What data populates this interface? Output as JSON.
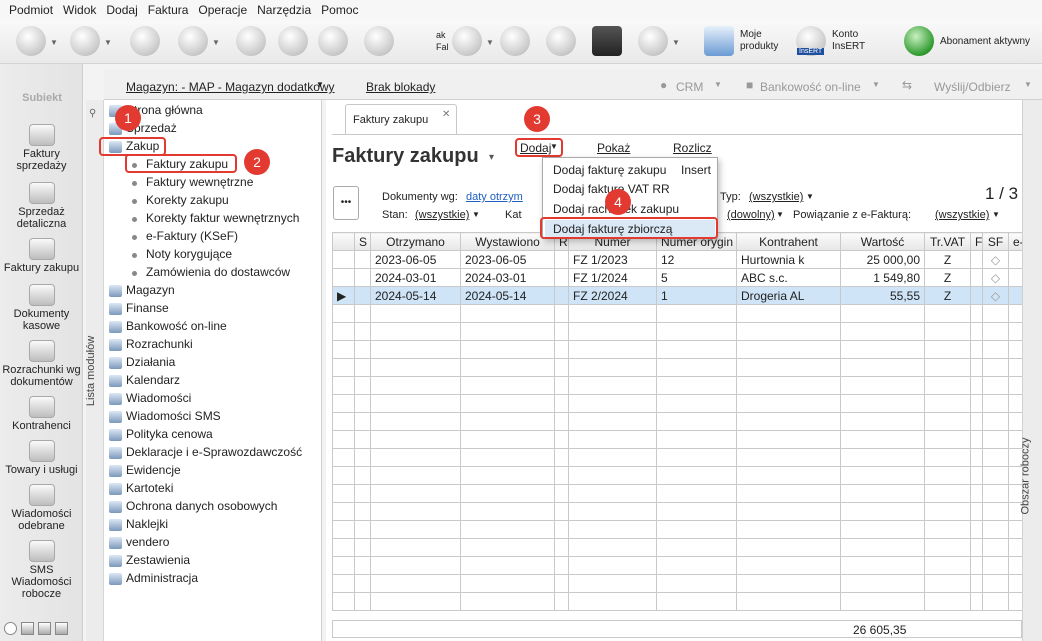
{
  "menu": [
    "Podmiot",
    "Widok",
    "Dodaj",
    "Faktura",
    "Operacje",
    "Narzędzia",
    "Pomoc"
  ],
  "toolbar": {
    "partial_text": "ak\nFal",
    "moje_produkty": "Moje\nprodukty",
    "konto_insert": "Konto\nInsERT",
    "insert_logo": "InsERT",
    "abonament": "Abonament aktywny"
  },
  "logo": "Subiekt",
  "left_nav": [
    "Faktury sprzedaży",
    "Sprzedaż detaliczna",
    "Faktury zakupu",
    "Dokumenty kasowe",
    "Rozrachunki wg dokumentów",
    "Kontrahenci",
    "Towary i usługi",
    "Wiadomości odebrane",
    "SMS Wiadomości robocze"
  ],
  "topstrip": {
    "magazyn": "Magazyn: - MAP - Magazyn dodatkowy",
    "blokady": "Brak blokady",
    "crm": "CRM",
    "bankowosc": "Bankowość on-line",
    "wyslij": "Wyślij/Odbierz"
  },
  "modules_label": "Lista modułów",
  "modules": [
    "Strona główna",
    "Sprzedaż",
    "Zakup"
  ],
  "zakup_sub": [
    "Faktury zakupu",
    "Faktury wewnętrzne",
    "Korekty zakupu",
    "Korekty faktur wewnętrznych",
    "e-Faktury (KSeF)",
    "Noty korygujące",
    "Zamówienia do dostawców"
  ],
  "modules_after": [
    "Magazyn",
    "Finanse",
    "Bankowość on-line",
    "Rozrachunki",
    "Działania",
    "Kalendarz",
    "Wiadomości",
    "Wiadomości SMS",
    "Polityka cenowa",
    "Deklaracje i e-Sprawozdawczość",
    "Ewidencje",
    "Kartoteki",
    "Ochrona danych osobowych",
    "Naklejki",
    "vendero",
    "Zestawienia",
    "Administracja"
  ],
  "tab": {
    "label": "Faktury zakupu",
    "close": "✕"
  },
  "page_title": "Faktury zakupu",
  "actions": {
    "dodaj": "Dodaj",
    "pokaz": "Pokaż",
    "rozlicz": "Rozlicz"
  },
  "dropdown": [
    {
      "label": "Dodaj fakturę zakupu",
      "shortcut": "Insert"
    },
    {
      "label": "Dodaj fakturę VAT RR",
      "shortcut": ""
    },
    {
      "label": "Dodaj rachunek zakupu",
      "shortcut": ""
    },
    {
      "label": "Dodaj fakturę zbiorczą",
      "shortcut": ""
    }
  ],
  "filters": {
    "more": "•••",
    "dokumenty_label": "Dokumenty wg:",
    "dokumenty_value": "daty otrzym",
    "typ_label": "Typ:",
    "typ_value": "(wszystkie)",
    "stan_label": "Stan:",
    "stan_value": "(wszystkie)",
    "k_label": "Kat",
    "dowolny": "(dowolny)",
    "powiazanie_label": "Powiązanie z e-Fakturą:",
    "powiazanie_value": "(wszystkie)",
    "page": "1 / 3"
  },
  "table": {
    "headers": [
      "",
      "S",
      "Otrzymano",
      "Wystawiono",
      "R",
      "Numer",
      "Numer orygin",
      "Kontrahent",
      "Wartość",
      "Tr.VAT",
      "F",
      "SF",
      "e-"
    ],
    "rows": [
      [
        "",
        "",
        "2023-06-05",
        "2023-06-05",
        "",
        "FZ 1/2023",
        "12",
        "Hurtownia k",
        "25 000,00",
        "Z",
        "",
        "",
        ""
      ],
      [
        "",
        "",
        "2024-03-01",
        "2024-03-01",
        "",
        "FZ 1/2024",
        "5",
        "ABC s.c.",
        "1 549,80",
        "Z",
        "",
        "",
        ""
      ],
      [
        "▶",
        "",
        "2024-05-14",
        "2024-05-14",
        "",
        "FZ 2/2024",
        "1",
        "Drogeria AL",
        "55,55",
        "Z",
        "",
        "",
        ""
      ]
    ],
    "total": "26 605,35"
  },
  "right_panel_label": "Obszar roboczy",
  "badges": [
    "1",
    "2",
    "3",
    "4"
  ],
  "colors": {
    "accent_red": "#e23a30",
    "selection": "#cfe4f7",
    "link": "#1f5fbf"
  }
}
